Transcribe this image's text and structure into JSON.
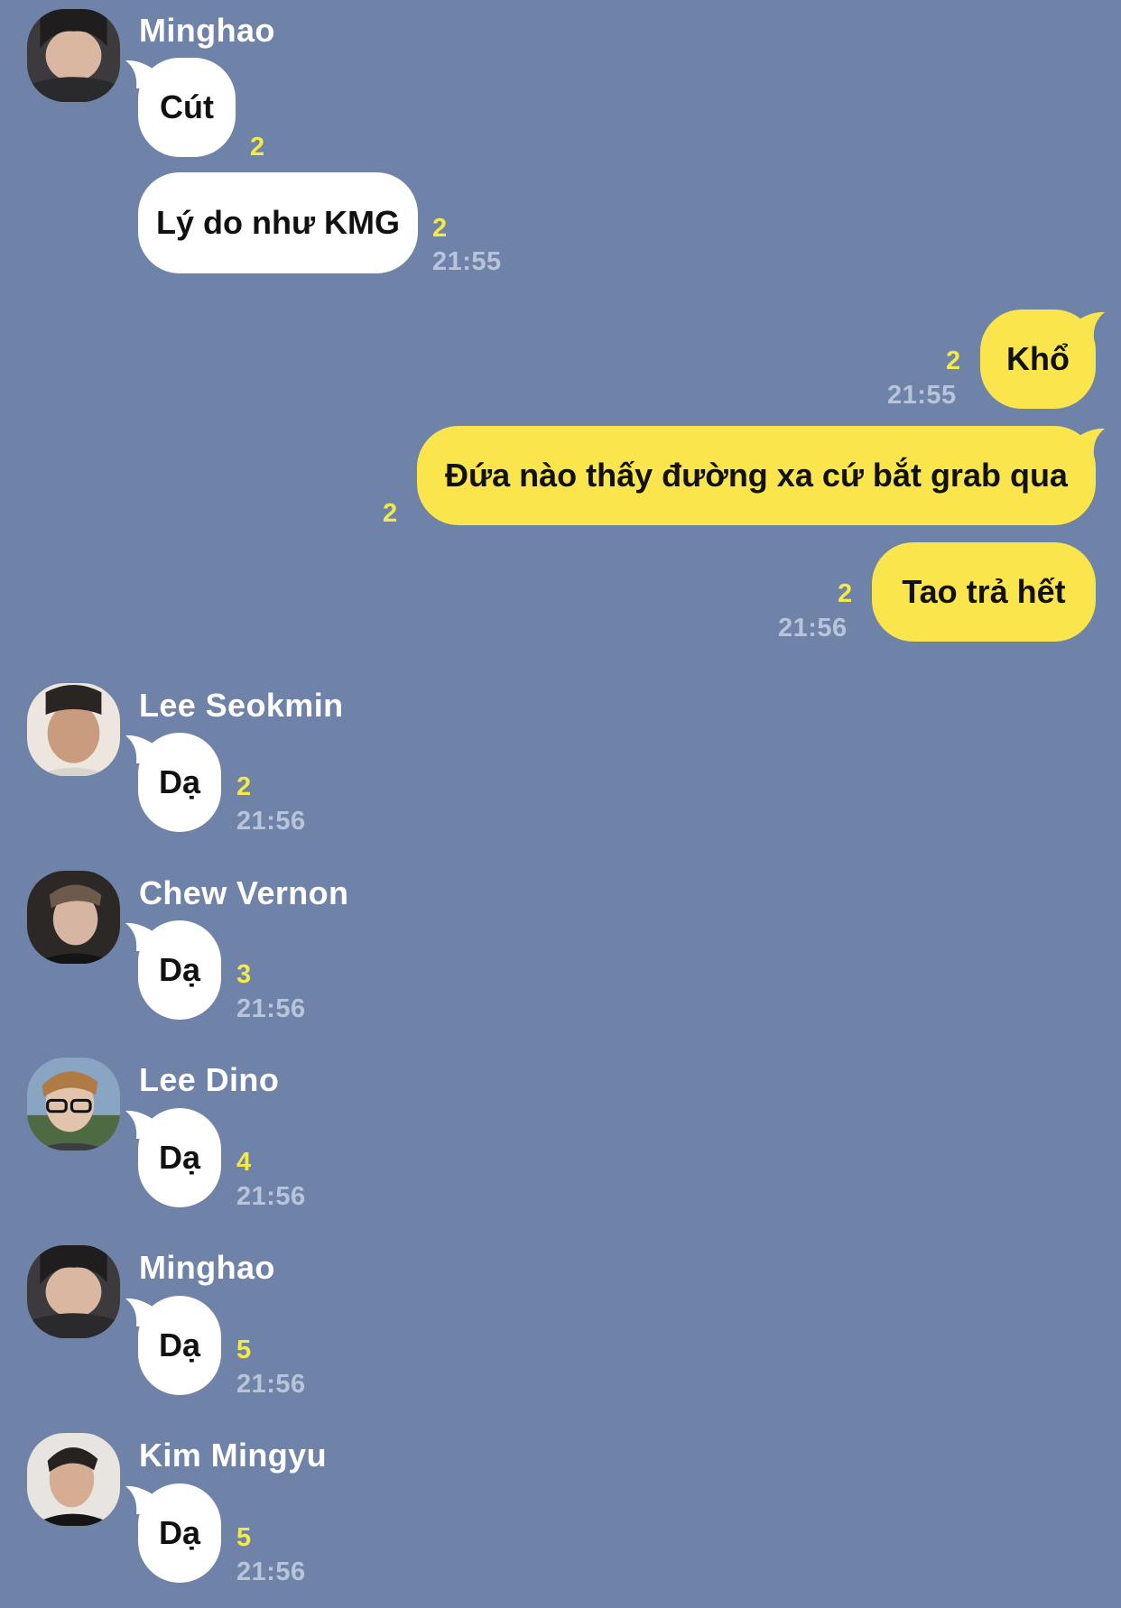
{
  "chat": {
    "messages": [
      {
        "sender": "Minghao",
        "text": "Cút",
        "count": "2"
      },
      {
        "text": "Lý do như KMG",
        "count": "2",
        "time": "21:55"
      },
      {
        "text": "Khổ",
        "count": "2",
        "time": "21:55"
      },
      {
        "text": "Đứa nào thấy đường xa cứ bắt grab qua",
        "count": "2"
      },
      {
        "text": "Tao trả hết",
        "count": "2",
        "time": "21:56"
      },
      {
        "sender": "Lee Seokmin",
        "text": "Dạ",
        "count": "2",
        "time": "21:56"
      },
      {
        "sender": "Chew Vernon",
        "text": "Dạ",
        "count": "3",
        "time": "21:56"
      },
      {
        "sender": "Lee Dino",
        "text": "Dạ",
        "count": "4",
        "time": "21:56"
      },
      {
        "sender": "Minghao",
        "text": "Dạ",
        "count": "5",
        "time": "21:56"
      },
      {
        "sender": "Kim Mingyu",
        "text": "Dạ",
        "count": "5",
        "time": "21:56"
      }
    ]
  },
  "colors": {
    "background": "#6f83a9",
    "incoming_bubble": "#ffffff",
    "outgoing_bubble": "#fbe54d",
    "unread_count": "#f4e94a",
    "timestamp": "#b8c4da"
  }
}
